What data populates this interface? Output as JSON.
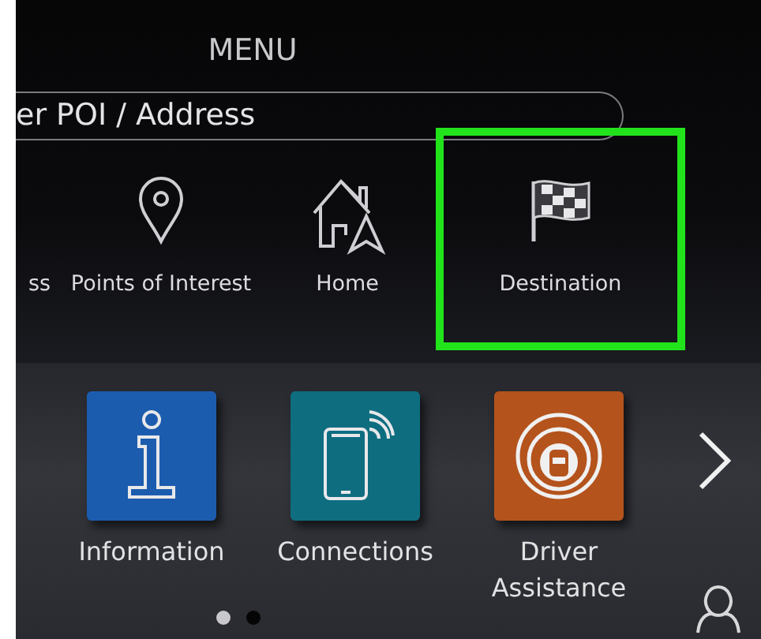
{
  "title": "MENU",
  "search": {
    "value": "er POI / Address"
  },
  "nav_items": [
    {
      "label": "ss",
      "kind": "none",
      "highlighted": false
    },
    {
      "label": "Points of Interest",
      "kind": "pin",
      "highlighted": false
    },
    {
      "label": "Home",
      "kind": "home",
      "highlighted": false
    },
    {
      "label": "Destination",
      "kind": "flag",
      "highlighted": true
    }
  ],
  "apps": [
    {
      "label": "Information",
      "kind": "info",
      "color": "#1c5cae"
    },
    {
      "label": "Connections",
      "kind": "phone",
      "color": "#0f6d80"
    },
    {
      "label": "Driver Assistance",
      "kind": "car",
      "color": "#b4531c"
    }
  ],
  "page_dots": [
    {
      "selected": true
    },
    {
      "selected": false
    }
  ]
}
